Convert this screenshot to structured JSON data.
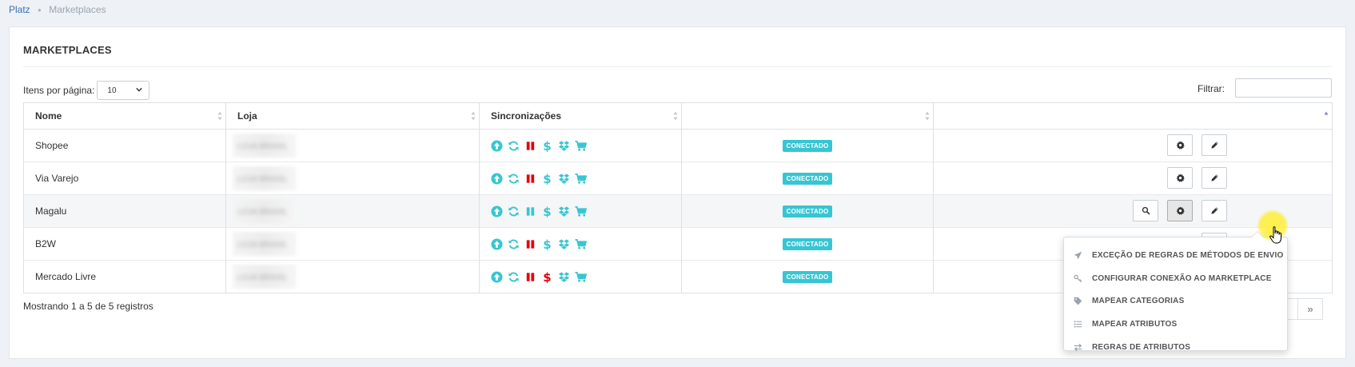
{
  "breadcrumb": {
    "home": "Platz",
    "current": "Marketplaces"
  },
  "panel": {
    "title": "MARKETPLACES"
  },
  "perpage": {
    "label": "Itens por página:",
    "value": "10"
  },
  "filter": {
    "label": "Filtrar:",
    "value": ""
  },
  "table": {
    "headers": {
      "nome": "Nome",
      "loja": "Loja",
      "sync": "Sincronizações"
    },
    "rows": [
      {
        "nome": "Shopee",
        "loja": "LOJA BRASIL",
        "status": "CONECTADO"
      },
      {
        "nome": "Via Varejo",
        "loja": "LOJA BRASIL",
        "status": "CONECTADO"
      },
      {
        "nome": "Magalu",
        "loja": "LOJA BRASIL",
        "status": "CONECTADO"
      },
      {
        "nome": "B2W",
        "loja": "LOJA BRASIL",
        "status": "CONECTADO"
      },
      {
        "nome": "Mercado Livre",
        "loja": "LOJA BRASIL",
        "status": "CONECTADO"
      }
    ]
  },
  "footer": {
    "info": "Mostrando 1 a 5 de 5 registros"
  },
  "dropdown": {
    "items": [
      {
        "label": "EXCEÇÃO DE REGRAS DE MÉTODOS DE ENVIO",
        "icon": "paper-plane-icon"
      },
      {
        "label": "CONFIGURAR CONEXÃO AO MARKETPLACE",
        "icon": "key-icon"
      },
      {
        "label": "MAPEAR CATEGORIAS",
        "icon": "tag-icon"
      },
      {
        "label": "MAPEAR ATRIBUTOS",
        "icon": "list-icon"
      },
      {
        "label": "REGRAS DE ATRIBUTOS",
        "icon": "exchange-icon"
      }
    ]
  },
  "colors": {
    "accent": "#36c6d3",
    "danger": "#e7000b",
    "link": "#3a6fb0"
  }
}
